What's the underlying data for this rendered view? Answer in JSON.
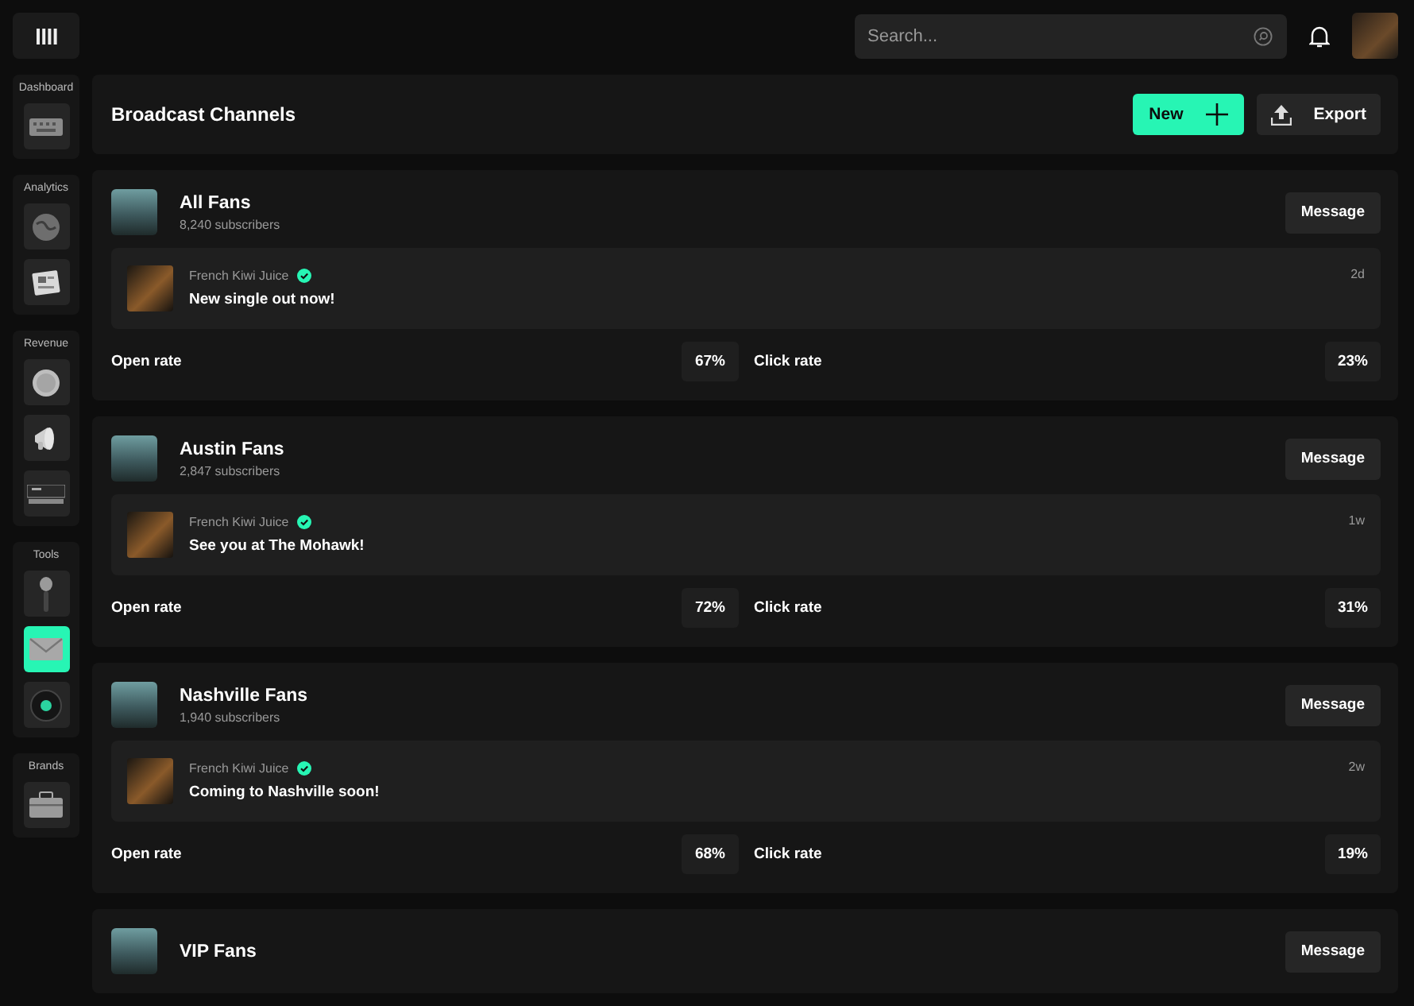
{
  "sidebar": {
    "groups": [
      {
        "label": "Dashboard",
        "items": [
          {
            "selected": false
          }
        ]
      },
      {
        "label": "Analytics",
        "items": [
          {
            "selected": false
          },
          {
            "selected": false
          }
        ]
      },
      {
        "label": "Revenue",
        "items": [
          {
            "selected": false
          },
          {
            "selected": false
          },
          {
            "selected": false
          }
        ]
      },
      {
        "label": "Tools",
        "items": [
          {
            "selected": false
          },
          {
            "selected": true
          },
          {
            "selected": false
          }
        ]
      },
      {
        "label": "Brands",
        "items": [
          {
            "selected": false
          }
        ]
      }
    ]
  },
  "search": {
    "placeholder": "Search..."
  },
  "header": {
    "title": "Broadcast Channels",
    "buttons": [
      {
        "label": "New",
        "kind": "primary"
      },
      {
        "label": "Export",
        "kind": "secondary"
      }
    ]
  },
  "channels": [
    {
      "name": "All Fans",
      "subscribers": "8,240 subscribers",
      "action": "Message",
      "message": {
        "sender": "French Kiwi Juice",
        "verified": true,
        "text": "New single out now!",
        "time": "2d"
      },
      "stats": [
        {
          "label": "Open rate",
          "value": "67%"
        },
        {
          "label": "Click rate",
          "value": "23%"
        }
      ]
    },
    {
      "name": "Austin Fans",
      "subscribers": "2,847 subscribers",
      "action": "Message",
      "message": {
        "sender": "French Kiwi Juice",
        "verified": true,
        "text": "See you at The Mohawk!",
        "time": "1w"
      },
      "stats": [
        {
          "label": "Open rate",
          "value": "72%"
        },
        {
          "label": "Click rate",
          "value": "31%"
        }
      ]
    },
    {
      "name": "Nashville Fans",
      "subscribers": "1,940 subscribers",
      "action": "Message",
      "message": {
        "sender": "French Kiwi Juice",
        "verified": true,
        "text": "Coming to Nashville soon!",
        "time": "2w"
      },
      "stats": [
        {
          "label": "Open rate",
          "value": "68%"
        },
        {
          "label": "Click rate",
          "value": "19%"
        }
      ]
    },
    {
      "name": "VIP Fans",
      "action": "Message"
    }
  ]
}
